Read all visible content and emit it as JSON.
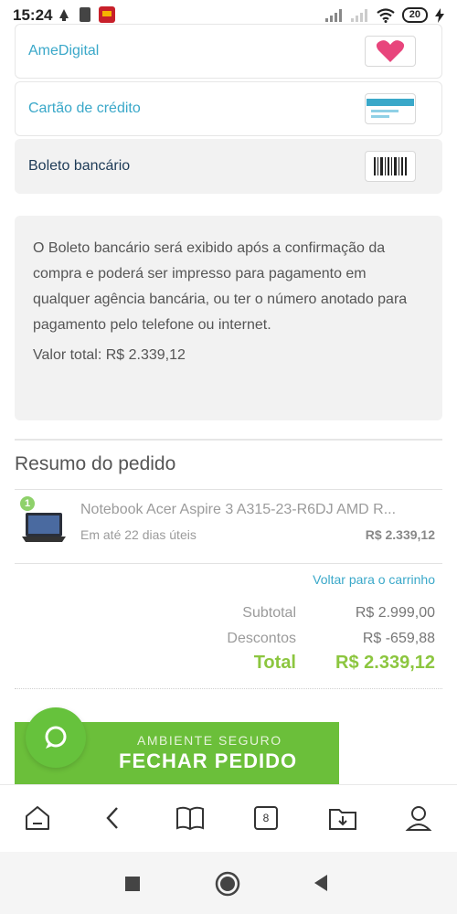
{
  "status_bar": {
    "time": "15:24",
    "battery": "20"
  },
  "payment_options": [
    {
      "label": "AmeDigital",
      "icon": "heart-icon"
    },
    {
      "label": "Cartão de crédito",
      "icon": "credit-card-icon"
    },
    {
      "label": "Boleto bancário",
      "icon": "barcode-icon",
      "selected": true
    }
  ],
  "boleto_info": {
    "text": "O Boleto bancário será exibido após a confirmação da compra e poderá ser impresso para pagamento em qualquer agência bancária, ou ter o número anotado para pagamento pelo telefone ou internet.",
    "total": "Valor total: R$ 2.339,12"
  },
  "summary": {
    "title": "Resumo do pedido",
    "item": {
      "quantity": "1",
      "name": "Notebook Acer Aspire 3 A315-23-R6DJ AMD R...",
      "delivery": "Em até 22 dias úteis",
      "price": "R$ 2.339,12"
    },
    "back_link": "Voltar para o carrinho",
    "subtotal_label": "Subtotal",
    "subtotal_value": "R$ 2.999,00",
    "discount_label": "Descontos",
    "discount_value": "R$ -659,88",
    "total_label": "Total",
    "total_value": "R$ 2.339,12"
  },
  "checkout": {
    "sub_label": "AMBIENTE SEGURO",
    "label": "FECHAR PEDIDO"
  },
  "toolbar": {
    "tab_count": "8"
  },
  "colors": {
    "accent_blue": "#3aa8c9",
    "green": "#6bbf3a",
    "total_green": "#8cc63f"
  }
}
